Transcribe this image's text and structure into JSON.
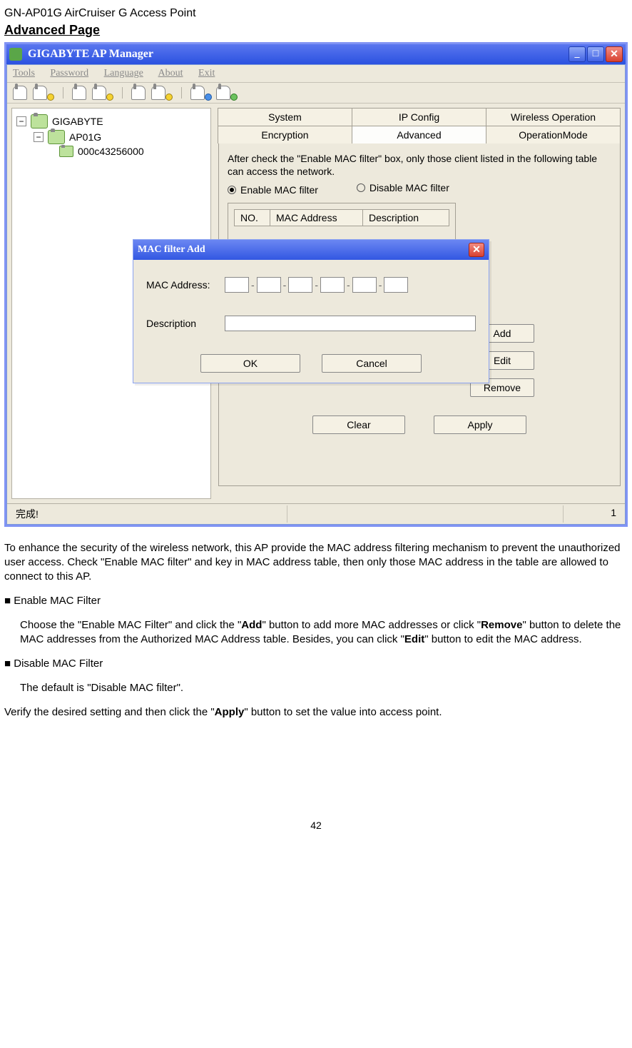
{
  "doc": {
    "header": "GN-AP01G AirCruiser G Access Point",
    "section_title": "Advanced Page",
    "page_number": "42"
  },
  "outer_window": {
    "title": "GIGABYTE AP Manager",
    "menubar": [
      "Tools",
      "Password",
      "Language",
      "About",
      "Exit"
    ]
  },
  "tree": {
    "root": "GIGABYTE",
    "child": "AP01G",
    "leaf": "000c43256000"
  },
  "tabs": {
    "row1": [
      "System",
      "IP Config",
      "Wireless Operation"
    ],
    "row2": [
      "Encryption",
      "Advanced",
      "OperationMode"
    ],
    "active": "Advanced"
  },
  "hint": "After check the \"Enable MAC filter\" box, only those client listed in the following table can access the network.",
  "radios": {
    "enable": "Enable MAC filter",
    "disable": "Disable MAC filter"
  },
  "mac_table": {
    "headers": [
      "NO.",
      "MAC Address",
      "Description"
    ]
  },
  "right_buttons": {
    "add": "Add",
    "edit": "Edit",
    "remove": "Remove"
  },
  "bottom_buttons": {
    "clear": "Clear",
    "apply": "Apply"
  },
  "dialog": {
    "title": "MAC filter Add",
    "mac_label": "MAC Address:",
    "desc_label": "Description",
    "ok": "OK",
    "cancel": "Cancel"
  },
  "statusbar": {
    "left": "完成!",
    "right": "1"
  },
  "body": {
    "p1": "To enhance the security of the wireless network, this AP provide the MAC address filtering mechanism to prevent the unauthorized user access. Check \"Enable MAC filter\" and key in MAC address table, then only those MAC address in the table are allowed to connect to this AP.",
    "h1": "Enable MAC Filter",
    "p2a": "Choose the \"Enable MAC Filter\" and click the \"",
    "p2b": "Add",
    "p2c": "\" button to add more MAC addresses or click \"",
    "p2d": "Remove",
    "p2e": "\" button to delete the MAC addresses from the Authorized MAC Address table. Besides, you can click \"",
    "p2f": "Edit",
    "p2g": "\" button to edit the MAC address.",
    "h2": "Disable MAC Filter",
    "p3": "The default is \"Disable MAC filter\".",
    "p4a": "Verify the desired setting and then click the \"",
    "p4b": "Apply",
    "p4c": "\" button to set the value into access point."
  }
}
